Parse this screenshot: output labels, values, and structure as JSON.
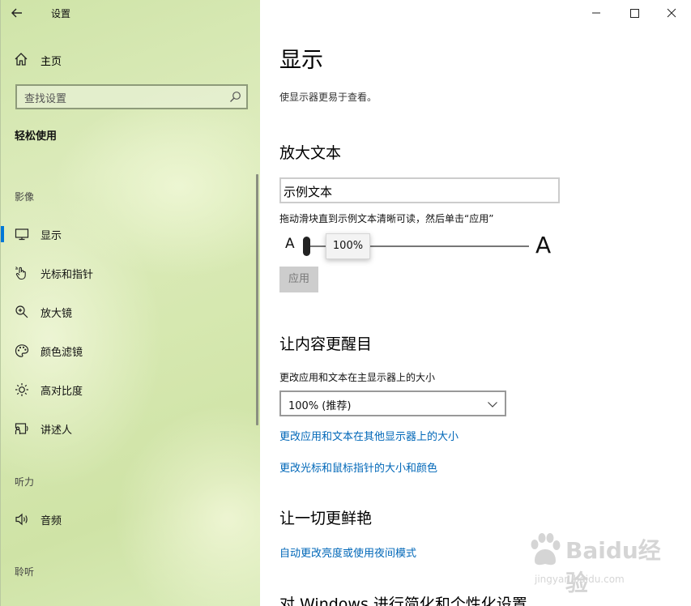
{
  "app": {
    "title": "设置"
  },
  "sidebar": {
    "home_label": "主页",
    "search_placeholder": "查找设置",
    "section": "轻松使用",
    "groups": [
      {
        "label": "影像"
      },
      {
        "label": "听力"
      },
      {
        "label": "聆听"
      }
    ],
    "items": [
      {
        "label": "显示",
        "icon": "monitor-icon",
        "selected": true
      },
      {
        "label": "光标和指针",
        "icon": "pointer-icon",
        "selected": false
      },
      {
        "label": "放大镜",
        "icon": "magnifier-icon",
        "selected": false
      },
      {
        "label": "颜色滤镜",
        "icon": "palette-icon",
        "selected": false
      },
      {
        "label": "高对比度",
        "icon": "brightness-icon",
        "selected": false
      },
      {
        "label": "讲述人",
        "icon": "narrator-icon",
        "selected": false
      },
      {
        "label": "音频",
        "icon": "speaker-icon",
        "selected": false
      }
    ]
  },
  "main": {
    "title": "显示",
    "description": "使显示器更易于查看。",
    "make_text_bigger": {
      "heading": "放大文本",
      "sample_text": "示例文本",
      "instruction": "拖动滑块直到示例文本清晰可读，然后单击“应用”",
      "small_a": "A",
      "large_a": "A",
      "slider_value": "100%",
      "apply_label": "应用"
    },
    "make_everything_bigger": {
      "heading": "让内容更醒目",
      "size_label": "更改应用和文本在主显示器上的大小",
      "size_value": "100% (推荐)",
      "link_other_displays": "更改应用和文本在其他显示器上的大小",
      "link_cursor": "更改光标和鼠标指针的大小和颜色"
    },
    "make_everything_brighter": {
      "heading": "让一切更鲜艳",
      "link_brightness": "自动更改亮度或使用夜间模式"
    },
    "simplify_heading": "对 Windows 进行简化和个性化设置"
  },
  "watermark": {
    "brand": "Baidu经验",
    "url": "jingyan.baidu.com"
  },
  "colors": {
    "accent": "#0078d7",
    "link": "#0067b8"
  }
}
